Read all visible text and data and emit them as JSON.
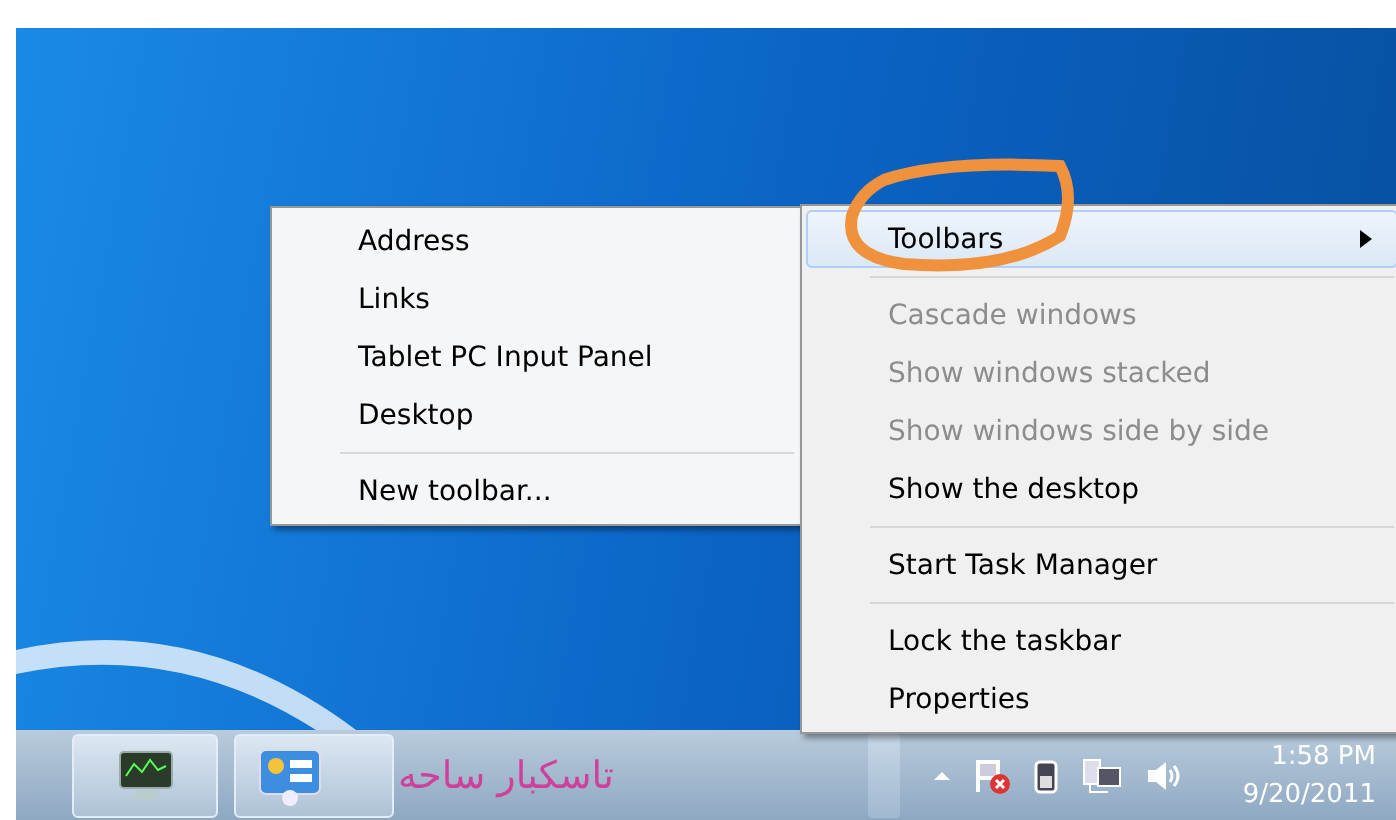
{
  "context_menu": {
    "items": [
      {
        "kind": "item",
        "label": "Toolbars",
        "selected": true,
        "disabled": false,
        "submenu": true
      },
      {
        "kind": "separator"
      },
      {
        "kind": "item",
        "label": "Cascade windows",
        "selected": false,
        "disabled": true,
        "submenu": false
      },
      {
        "kind": "item",
        "label": "Show windows stacked",
        "selected": false,
        "disabled": true,
        "submenu": false
      },
      {
        "kind": "item",
        "label": "Show windows side by side",
        "selected": false,
        "disabled": true,
        "submenu": false
      },
      {
        "kind": "item",
        "label": "Show the desktop",
        "selected": false,
        "disabled": false,
        "submenu": false
      },
      {
        "kind": "separator"
      },
      {
        "kind": "item",
        "label": "Start Task Manager",
        "selected": false,
        "disabled": false,
        "submenu": false
      },
      {
        "kind": "separator"
      },
      {
        "kind": "item",
        "label": "Lock the taskbar",
        "selected": false,
        "disabled": false,
        "submenu": false
      },
      {
        "kind": "item",
        "label": "Properties",
        "selected": false,
        "disabled": false,
        "submenu": false
      }
    ]
  },
  "toolbars_submenu": {
    "items": [
      {
        "kind": "item",
        "label": "Address"
      },
      {
        "kind": "item",
        "label": "Links"
      },
      {
        "kind": "item",
        "label": "Tablet PC Input Panel"
      },
      {
        "kind": "item",
        "label": "Desktop"
      },
      {
        "kind": "separator"
      },
      {
        "kind": "item",
        "label": "New toolbar..."
      }
    ]
  },
  "annotation": {
    "text": "تاسکبار ساحه"
  },
  "taskbar": {
    "clock": {
      "time": "1:58 PM",
      "date": "9/20/2011"
    }
  }
}
